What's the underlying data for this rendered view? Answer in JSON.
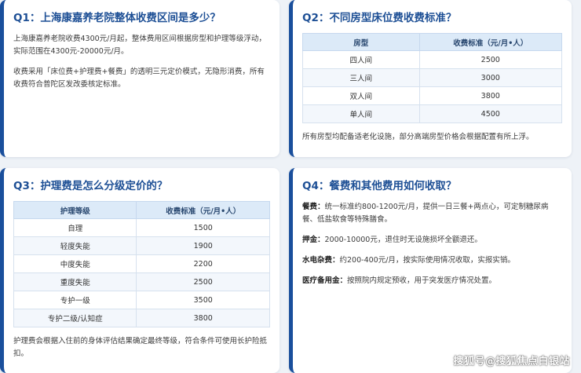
{
  "q1": {
    "title": "Q1：上海康嘉养老院整体收费区间是多少？",
    "para1": "上海康嘉养老院收费4300元/月起，整体费用区间根据房型和护理等级浮动，实际范围在4300元-20000元/月。",
    "para2": "收费采用「床位费+护理费+餐费」的透明三元定价模式，无隐形消费，所有收费符合普陀区发改委核定标准。"
  },
  "q2": {
    "title": "Q2：不同房型床位费收费标准？",
    "headers": [
      "房型",
      "收费标准（元/月•人）"
    ],
    "rows": [
      [
        "四人间",
        "2500"
      ],
      [
        "三人间",
        "3000"
      ],
      [
        "双人间",
        "3800"
      ],
      [
        "单人间",
        "4500"
      ]
    ],
    "note": "所有房型均配备适老化设施，部分高端房型价格会根据配置有所上浮。"
  },
  "q3": {
    "title": "Q3：护理费是怎么分级定价的？",
    "headers": [
      "护理等级",
      "收费标准（元/月•人）"
    ],
    "rows": [
      [
        "自理",
        "1500"
      ],
      [
        "轻度失能",
        "1900"
      ],
      [
        "中度失能",
        "2200"
      ],
      [
        "重度失能",
        "2500"
      ],
      [
        "专护一级",
        "3500"
      ],
      [
        "专护二级/认知症",
        "3800"
      ]
    ],
    "note": "护理费会根据入住前的身体评估结果确定最终等级，符合条件可使用长护险抵扣。"
  },
  "q4": {
    "title": "Q4：餐费和其他费用如何收取？",
    "items": [
      {
        "label": "餐费：",
        "text": "统一标准约800-1200元/月，提供一日三餐+两点心，可定制糖尿病餐、低盐软食等特殊膳食。"
      },
      {
        "label": "押金：",
        "text": "2000-10000元，退住时无设施损坏全额退还。"
      },
      {
        "label": "水电杂费：",
        "text": "约200-400元/月，按实际使用情况收取，实报实销。"
      },
      {
        "label": "医疗备用金：",
        "text": "按照院内规定预收，用于突发医疗情况处置。"
      }
    ]
  },
  "watermark": "搜狐号@搜狐焦点白银站"
}
